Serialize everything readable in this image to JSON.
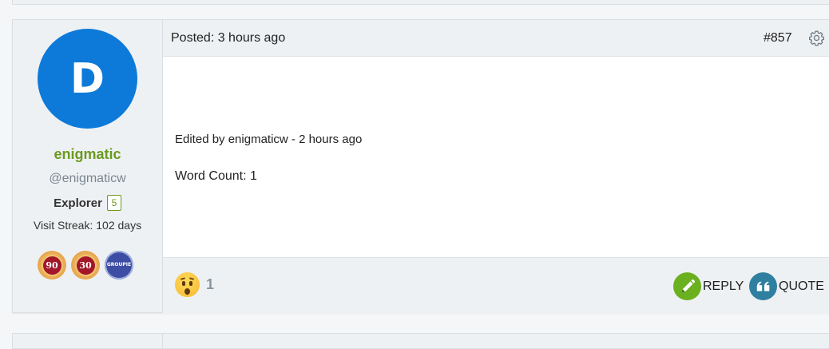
{
  "post": {
    "author": {
      "avatar_letter": "D",
      "name": "enigmatic",
      "handle": "@enigmaticw",
      "rank": "Explorer",
      "rank_level": "5",
      "visit_streak": "Visit Streak: 102 days",
      "badges": [
        {
          "label": "90",
          "icon": "streak-90-badge-icon"
        },
        {
          "label": "30",
          "icon": "streak-30-badge-icon"
        },
        {
          "label": "GROUPIE",
          "icon": "groupie-badge-icon"
        }
      ]
    },
    "posted": "Posted: 3 hours ago",
    "number": "#857",
    "edited": "Edited by enigmaticw - 2 hours ago",
    "word_count": "Word Count: 1",
    "reaction": {
      "icon": "astonished-face-icon",
      "count": "1"
    },
    "actions": {
      "reply_label": "REPLY",
      "quote_label": "QUOTE"
    }
  },
  "colors": {
    "avatar": "#0d7ad9",
    "username": "#6b9a1f",
    "reply": "#6bb01f",
    "quote": "#2f7fa0"
  }
}
